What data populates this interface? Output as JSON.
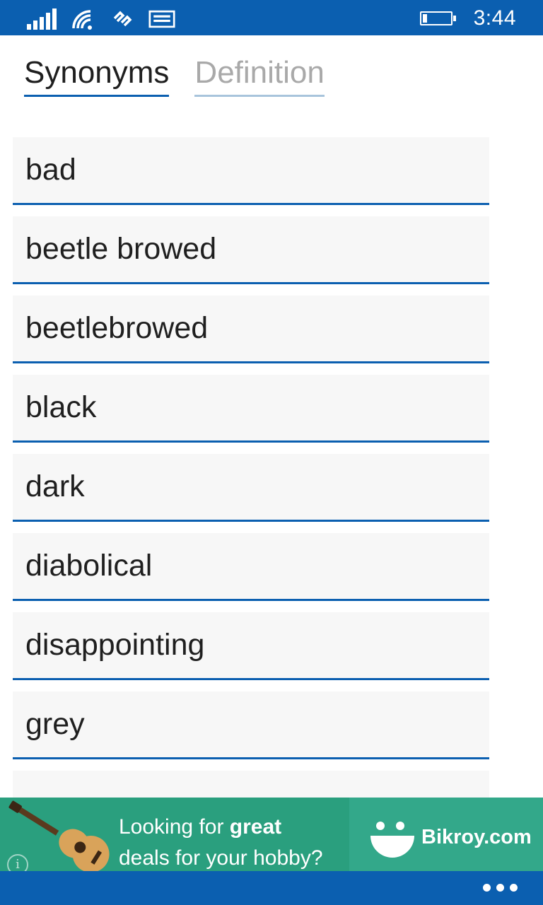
{
  "status_bar": {
    "time": "3:44",
    "signal_bars": 5,
    "icons": [
      "signal-icon",
      "wifi-icon",
      "data-sense-icon",
      "message-icon",
      "battery-icon"
    ],
    "battery_level": 0.15,
    "color": "#0b5fb0"
  },
  "pivot": {
    "tabs": [
      {
        "label": "Synonyms",
        "active": true
      },
      {
        "label": "Definition",
        "active": false
      }
    ]
  },
  "synonyms": {
    "items": [
      "bad",
      "beetle browed",
      "beetlebrowed",
      "black",
      "dark",
      "diabolical",
      "disappointing",
      "grey",
      ""
    ]
  },
  "ad": {
    "line1_prefix": "Looking for ",
    "line1_bold": "great",
    "line2": "deals for your hobby?",
    "brand": "Bikroy.com",
    "info_glyph": "i",
    "background": "#2a9f7e",
    "icons": [
      "guitar-icon",
      "info-icon",
      "smiley-logo-icon"
    ]
  },
  "app_bar": {
    "more_icon": "more-ellipsis-icon",
    "color": "#0b5fb0"
  }
}
